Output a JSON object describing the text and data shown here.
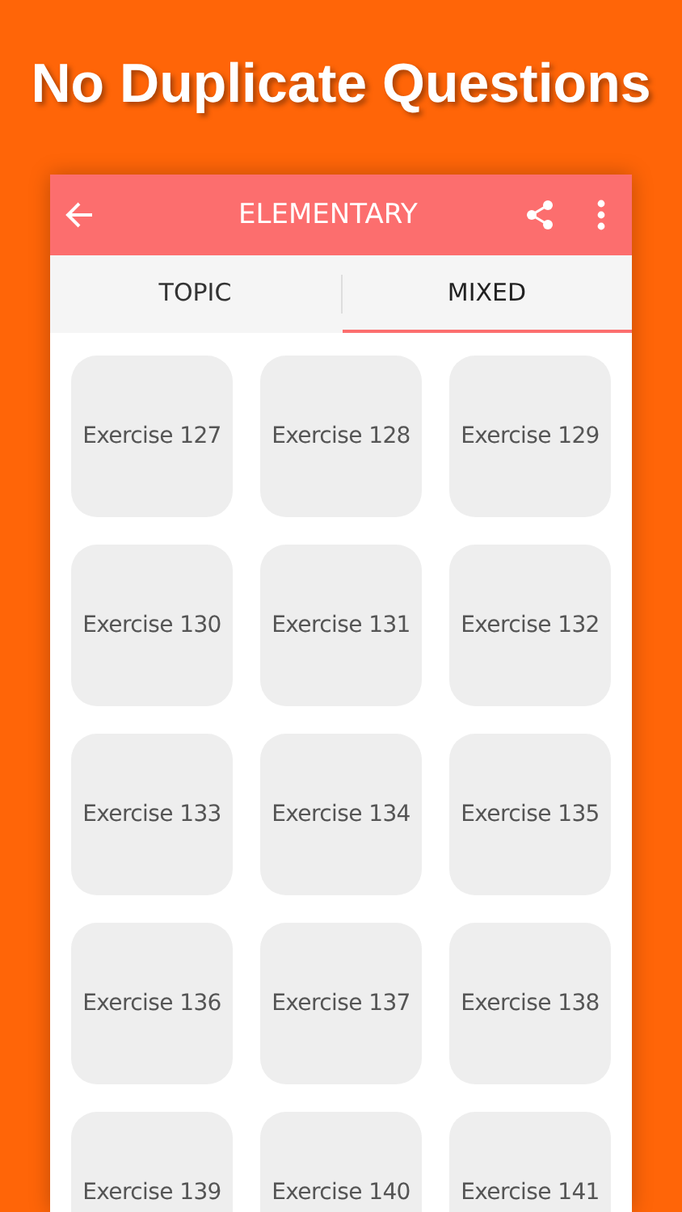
{
  "headline": "No Duplicate Questions",
  "toolbar": {
    "title": "ELEMENTARY"
  },
  "tabs": [
    {
      "label": "TOPIC",
      "selected": false
    },
    {
      "label": "MIXED",
      "selected": true
    }
  ],
  "exercises": [
    "Exercise 127",
    "Exercise 128",
    "Exercise 129",
    "Exercise 130",
    "Exercise 131",
    "Exercise 132",
    "Exercise 133",
    "Exercise 134",
    "Exercise 135",
    "Exercise 136",
    "Exercise 137",
    "Exercise 138",
    "Exercise 139",
    "Exercise 140",
    "Exercise 141"
  ]
}
